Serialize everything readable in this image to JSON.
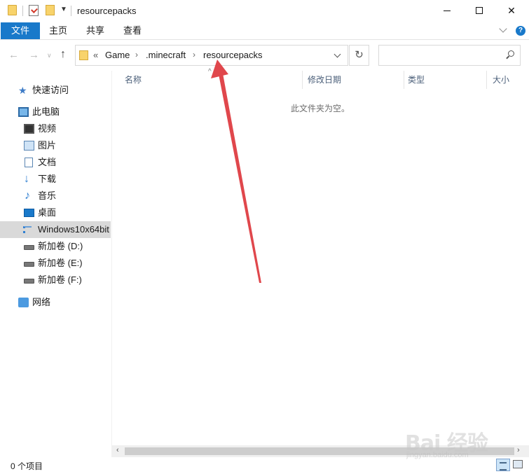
{
  "window": {
    "title": "resourcepacks",
    "minimize": "minimize",
    "maximize": "maximize",
    "close": "close"
  },
  "ribbon": {
    "tabs": [
      "文件",
      "主页",
      "共享",
      "查看"
    ]
  },
  "address": {
    "overflow": "«",
    "crumbs": [
      "Game",
      ".minecraft",
      "resourcepacks"
    ],
    "separator": "›",
    "search_placeholder": ""
  },
  "sidebar": {
    "quick_access": "快速访问",
    "this_pc": "此电脑",
    "items": [
      {
        "label": "视频",
        "icon": "video-icon"
      },
      {
        "label": "图片",
        "icon": "pictures-icon"
      },
      {
        "label": "文档",
        "icon": "documents-icon"
      },
      {
        "label": "下载",
        "icon": "download-icon"
      },
      {
        "label": "音乐",
        "icon": "music-icon"
      },
      {
        "label": "桌面",
        "icon": "desktop-icon"
      },
      {
        "label": "Windows10x64bit",
        "icon": "system-drive-icon"
      },
      {
        "label": "新加卷 (D:)",
        "icon": "drive-icon"
      },
      {
        "label": "新加卷 (E:)",
        "icon": "drive-icon"
      },
      {
        "label": "新加卷 (F:)",
        "icon": "drive-icon"
      }
    ],
    "network": "网络"
  },
  "columns": [
    "名称",
    "修改日期",
    "类型",
    "大小"
  ],
  "content": {
    "empty_message": "此文件夹为空。"
  },
  "status": {
    "item_count": "0 个项目"
  },
  "colors": {
    "accent": "#1979ca",
    "annotation_arrow": "#e0474c",
    "selected_bg": "#d9d9d9"
  },
  "watermark": {
    "main": "Bai 经验",
    "sub": "jingyan.baidu.com"
  }
}
